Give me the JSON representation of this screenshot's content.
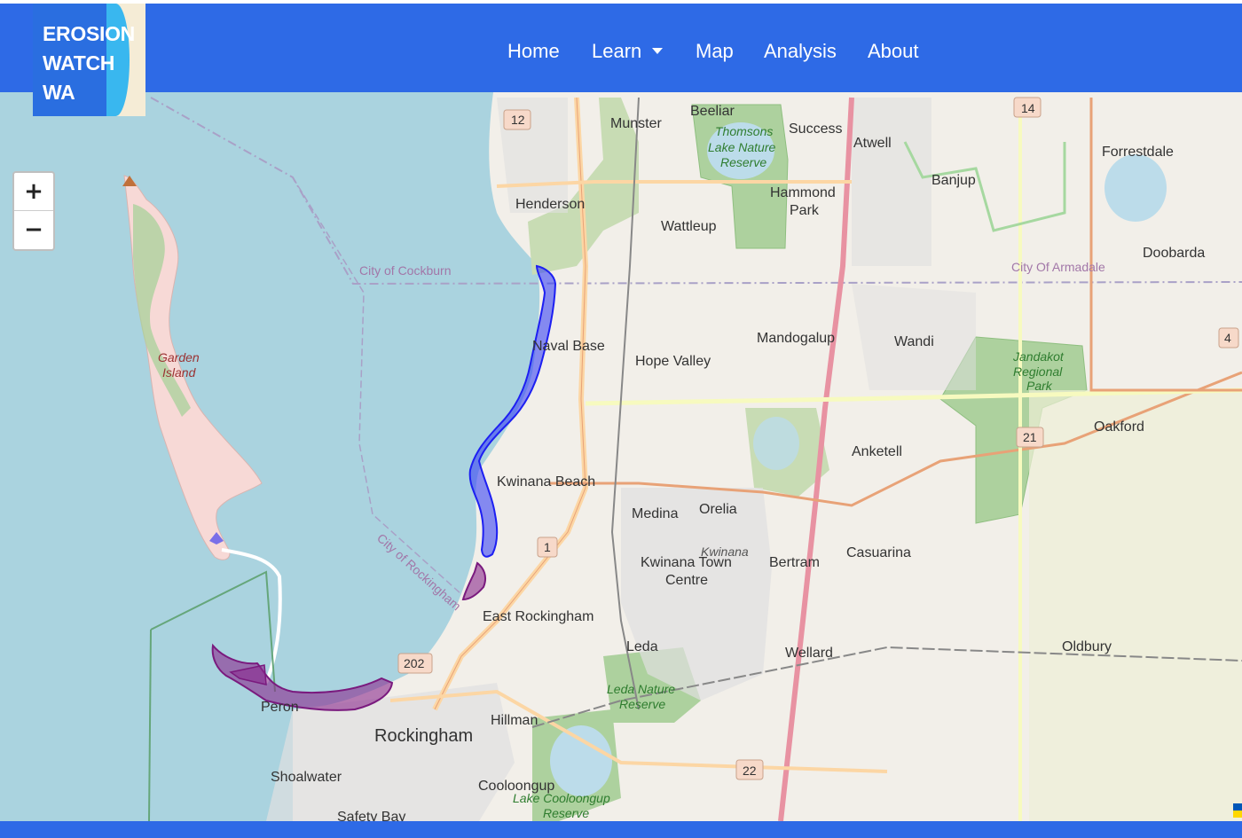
{
  "logo": {
    "text": "EROSION\nWATCH\nWA"
  },
  "nav": {
    "home": "Home",
    "learn": "Learn",
    "map": "Map",
    "analysis": "Analysis",
    "about": "About"
  },
  "zoom": {
    "in": "+",
    "out": "−"
  },
  "map": {
    "places": {
      "munster": "Munster",
      "beeliar": "Beeliar",
      "success": "Success",
      "atwell": "Atwell",
      "banjup": "Banjup",
      "forrestdale": "Forrestdale",
      "henderson": "Henderson",
      "hammond": "Hammond",
      "park": "Park",
      "wattleup": "Wattleup",
      "doobarda": "Doobarda",
      "naval_base": "Naval Base",
      "hope_valley": "Hope Valley",
      "mandogalup": "Mandogalup",
      "wandi": "Wandi",
      "oakford": "Oakford",
      "anketell": "Anketell",
      "kwinana_beach": "Kwinana Beach",
      "medina": "Medina",
      "orelia": "Orelia",
      "kwinana_town": "Kwinana Town",
      "centre": "Centre",
      "bertram": "Bertram",
      "casuarina": "Casuarina",
      "east_rockingham": "East Rockingham",
      "leda": "Leda",
      "wellard": "Wellard",
      "oldbury": "Oldbury",
      "hillman": "Hillman",
      "rockingham": "Rockingham",
      "peron": "Peron",
      "shoalwater": "Shoalwater",
      "cooloongup": "Cooloongup",
      "safety_bay": "Safety Bay"
    },
    "parks": {
      "thomsons_1": "Thomsons",
      "thomsons_2": "Lake Nature",
      "thomsons_3": "Reserve",
      "jandakot_1": "Jandakot",
      "jandakot_2": "Regional",
      "jandakot_3": "Park",
      "leda_1": "Leda Nature",
      "leda_2": "Reserve",
      "cooloongup_1": "Lake Cooloongup",
      "cooloongup_2": "Reserve",
      "kwinana": "Kwinana"
    },
    "island": {
      "line1": "Garden",
      "line2": "Island"
    },
    "boundaries": {
      "cockburn": "City of Cockburn",
      "armadale": "City Of Armadale",
      "rockingham": "City of Rockingham"
    },
    "routes": [
      "12",
      "14",
      "4",
      "21",
      "1",
      "202",
      "22"
    ],
    "erosion_colors": {
      "blue": "#3b44f5",
      "purple": "#8a2a8e"
    }
  }
}
